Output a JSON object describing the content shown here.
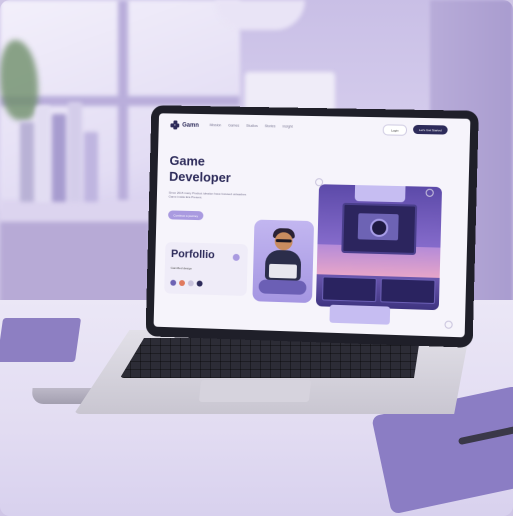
{
  "website": {
    "logo_name": "Gamn",
    "nav_links": [
      "Mission",
      "Games",
      "Studios",
      "Stories",
      "Insight"
    ],
    "nav_button_outline": "Login",
    "nav_button_solid": "Let's Get Started",
    "hero_title_line1": "Game",
    "hero_title_line2": "Developer",
    "hero_description": "Since 2015 many Product ideation have focused unleashes Game inside Era Present.",
    "hero_cta": "Continue a journey",
    "portfolio_title": "Porfollio",
    "portfolio_subtitle": "Gamified design"
  },
  "colors": {
    "brand_dark": "#2d2b5a",
    "accent_lavender": "#a99ae0",
    "scene_background": "#cfc6e6"
  }
}
